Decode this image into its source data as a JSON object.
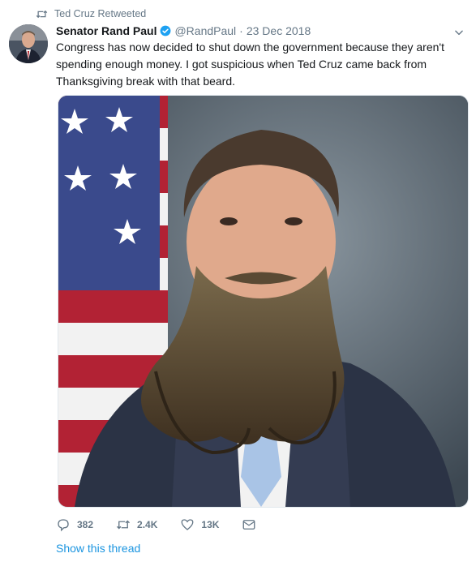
{
  "retweet": {
    "label": "Ted Cruz Retweeted"
  },
  "tweet": {
    "name": "Senator Rand Paul",
    "handle": "@RandPaul",
    "separator": "·",
    "date": "23 Dec 2018",
    "text": "Congress has now decided to shut down the government because they aren't spending enough money. I got suspicious when Ted Cruz came back from Thanksgiving break with that beard."
  },
  "actions": {
    "replies": "382",
    "retweets": "2.4K",
    "likes": "13K"
  },
  "show_thread": "Show this thread",
  "colors": {
    "accent": "#1b95e0",
    "muted": "#657786",
    "text": "#14171a"
  },
  "icons": [
    "retweet-icon",
    "verified-icon",
    "chevron-down-icon",
    "reply-icon",
    "retweet-icon",
    "heart-icon",
    "mail-icon"
  ]
}
